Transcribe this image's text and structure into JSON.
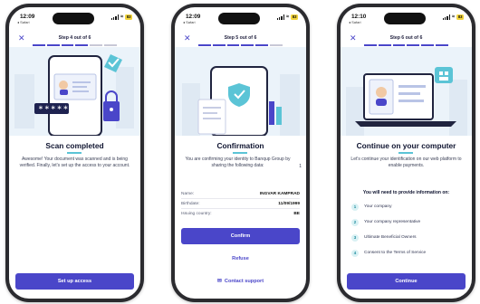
{
  "colors": {
    "accent": "#4a46c9",
    "teal": "#5bc4d6",
    "hero_bg": "#ebf3fa",
    "battery": "#f2d43c"
  },
  "phones": [
    {
      "status": {
        "time": "12:09",
        "back": "◂ Safari",
        "battery": "83"
      },
      "step": "Step 4 out of 6",
      "progress": {
        "done": 4,
        "total": 6
      },
      "title": "Scan completed",
      "body": "Awesome! Your document was scanned and is being verified. Finally, let's set up the access to your account.",
      "button": "Set up access",
      "illustration": {
        "stars": "∗∗∗∗∗"
      }
    },
    {
      "status": {
        "time": "12:09",
        "back": "◂ Safari",
        "battery": "83"
      },
      "step": "Step 5 out of 6",
      "progress": {
        "done": 5,
        "total": 6
      },
      "title": "Confirmation",
      "body": "You are confirming your identity to Banqup Group by sharing the following data:",
      "side_number": "1",
      "fields": [
        {
          "label": "Name:",
          "value": "INGVAR KAMPRAD"
        },
        {
          "label": "Birthdate:",
          "value": "11/09/1999"
        },
        {
          "label": "Issuing country:",
          "value": "BE"
        }
      ],
      "button": "Confirm",
      "refuse": "Refuse",
      "support": "Contact support"
    },
    {
      "status": {
        "time": "12:10",
        "back": "◂ Safari",
        "battery": "83"
      },
      "step": "Step 6 out of 6",
      "progress": {
        "done": 6,
        "total": 6
      },
      "title": "Continue on your computer",
      "body": "Let's continue your identification on our web platform to enable payments.",
      "need_title": "You will need to provide information on:",
      "items": [
        {
          "num": "1",
          "text": "Your company"
        },
        {
          "num": "2",
          "text": "Your company representative"
        },
        {
          "num": "3",
          "text": "Ultimate Beneficial Owners"
        },
        {
          "num": "4",
          "text": "Consent to the Terms of Service"
        }
      ],
      "button": "Continue"
    }
  ]
}
